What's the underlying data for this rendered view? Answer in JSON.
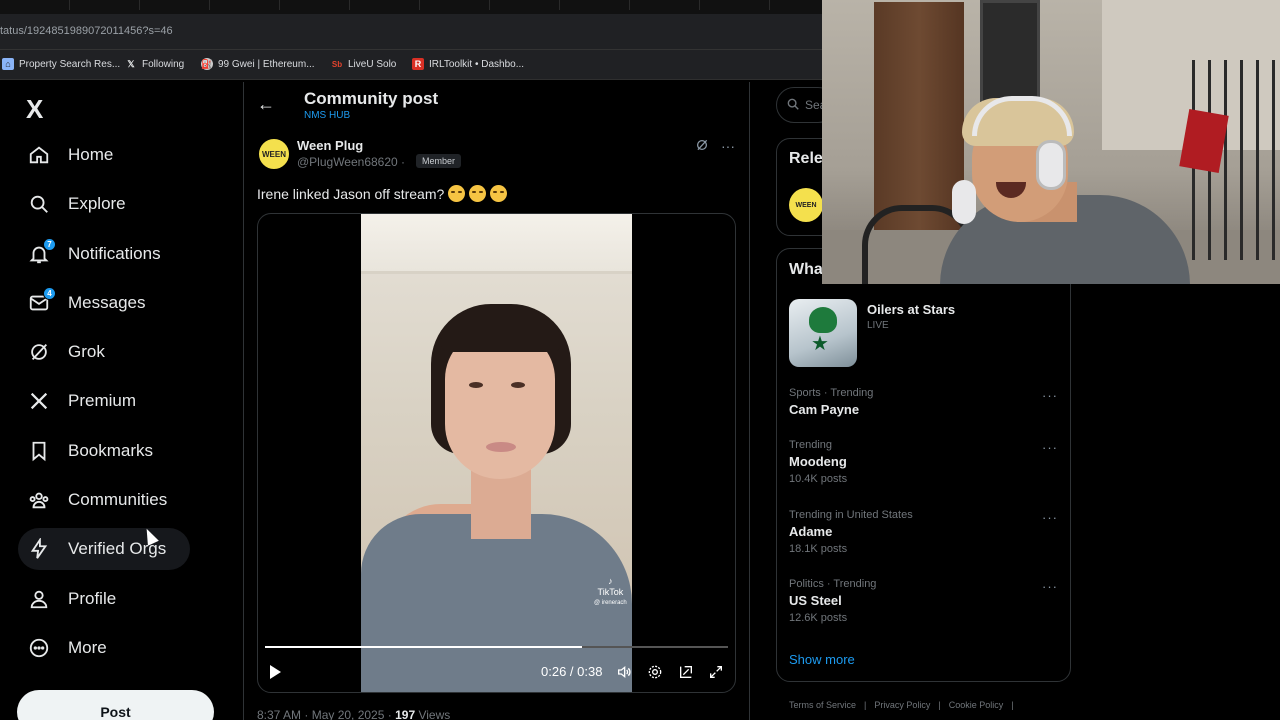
{
  "browser": {
    "url": "tatus/1924851989072011456?s=46",
    "bookmarks": [
      {
        "label": "Property Search Res...",
        "icon": "house-icon",
        "color": "#8ab4f8"
      },
      {
        "label": "Following",
        "icon": "x-icon",
        "color": "#e7e9ea"
      },
      {
        "label": "99 Gwei | Ethereum...",
        "icon": "gas-icon",
        "color": "#cccccc"
      },
      {
        "label": "LiveU Solo",
        "icon": "liveu-icon",
        "color": "#e3432d"
      },
      {
        "label": "IRLToolkit • Dashbo...",
        "icon": "irl-icon",
        "color": "#d93025"
      }
    ]
  },
  "nav": {
    "logo": "X",
    "items": [
      {
        "label": "Home",
        "icon": "home-icon"
      },
      {
        "label": "Explore",
        "icon": "search-icon"
      },
      {
        "label": "Notifications",
        "icon": "bell-icon",
        "badge": "7"
      },
      {
        "label": "Messages",
        "icon": "mail-icon",
        "badge": "4"
      },
      {
        "label": "Grok",
        "icon": "grok-icon"
      },
      {
        "label": "Premium",
        "icon": "x-premium-icon"
      },
      {
        "label": "Bookmarks",
        "icon": "bookmark-icon"
      },
      {
        "label": "Communities",
        "icon": "communities-icon"
      },
      {
        "label": "Verified Orgs",
        "icon": "lightning-icon"
      },
      {
        "label": "Profile",
        "icon": "person-icon"
      },
      {
        "label": "More",
        "icon": "more-circle-icon"
      }
    ],
    "post_label": "Post"
  },
  "main": {
    "title": "Community post",
    "subtitle": "NMS HUB",
    "author": {
      "name": "Ween Plug",
      "handle": "@PlugWeen68620 ·",
      "badge": "Member",
      "avatar_text": "WEEN"
    },
    "text": "Irene linked Jason off stream?",
    "emoji_count": 3,
    "video": {
      "progress": 0.684,
      "time": "0:26 / 0:38",
      "watermark_brand": "TikTok",
      "watermark_user": "@ irenerach"
    },
    "meta": {
      "timestamp": "8:37 AM · May 20, 2025 ·",
      "views": "197",
      "views_label": "Views"
    }
  },
  "right": {
    "search_placeholder": "Sea",
    "relevant_title": "Rele",
    "whats_title": "Wha",
    "live": {
      "title": "Oilers at Stars",
      "sub": "LIVE"
    },
    "trends": [
      {
        "ctx": "Sports · Trending",
        "name": "Cam Payne",
        "posts": ""
      },
      {
        "ctx": "Trending",
        "name": "Moodeng",
        "posts": "10.4K posts"
      },
      {
        "ctx": "Trending in United States",
        "name": "Adame",
        "posts": "18.1K posts"
      },
      {
        "ctx": "Politics · Trending",
        "name": "US Steel",
        "posts": "12.6K posts"
      }
    ],
    "show_more": "Show more",
    "footer": [
      "Terms of Service",
      "|",
      "Privacy Policy",
      "|",
      "Cookie Policy",
      "|"
    ]
  }
}
